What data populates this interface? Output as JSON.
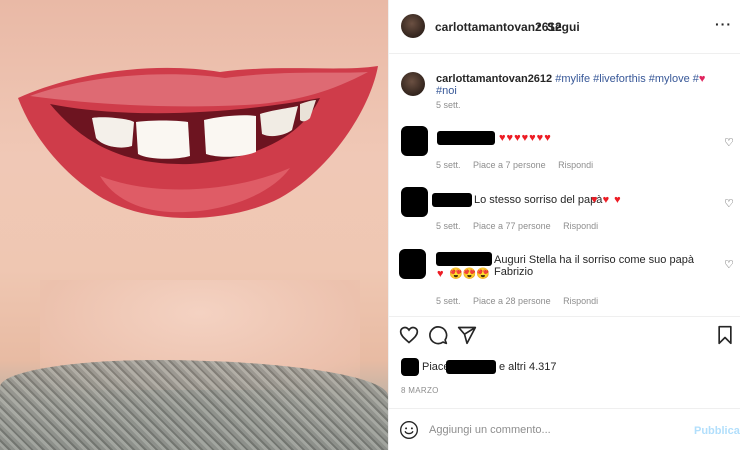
{
  "post": {
    "username": "carlottamantovan2612",
    "dot": "•",
    "follow_label": "Segui",
    "more_label": "···"
  },
  "caption": {
    "username": "carlottamantovan2612",
    "tags": "#mylife #liveforthis #mylove #",
    "tag_tail": "#noi",
    "time": "5 sett."
  },
  "comments": [
    {
      "text": "",
      "hearts": "♥♥♥♥♥♥♥",
      "time": "5 sett.",
      "likes": "Piace a 7 persone",
      "reply": "Rispondi"
    },
    {
      "text": "Lo stesso sorriso del papà",
      "hearts": "♥ ♥ ♥",
      "time": "5 sett.",
      "likes": "Piace a 77 persone",
      "reply": "Rispondi"
    },
    {
      "text": "Auguri Stella ha il sorriso come suo papà Fabrizio",
      "hearts": "♥",
      "faces": "😍😍😍",
      "time": "5 sett.",
      "likes": "Piace a 28 persone",
      "reply": "Rispondi"
    }
  ],
  "likes": {
    "prefix": "Piace",
    "suffix": "e altri 4.317"
  },
  "date": "8 MARZO",
  "comment_input": {
    "placeholder": "Aggiungi un commento...",
    "publish_label": "Pubblica"
  },
  "colors": {
    "heart": "#ed1c24",
    "hashtag": "#385898",
    "publish": "#b2dffc"
  },
  "icons": [
    "heart-icon",
    "comment-icon",
    "share-icon",
    "bookmark-icon",
    "emoji-icon",
    "more-icon"
  ]
}
